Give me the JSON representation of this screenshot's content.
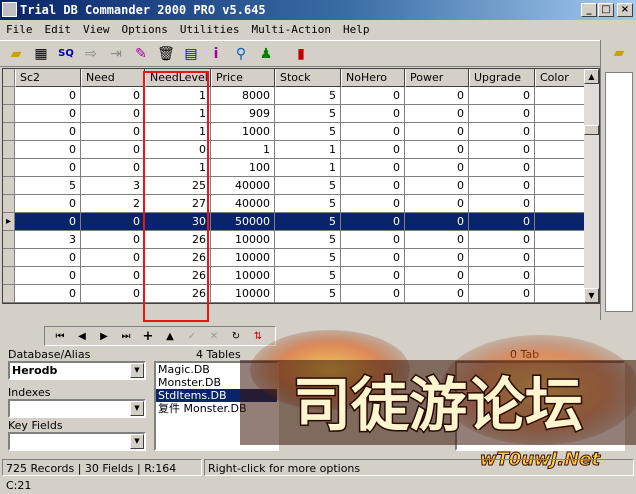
{
  "window": {
    "title": "Trial DB Commander 2000 PRO v5.645"
  },
  "menu": [
    "File",
    "Edit",
    "View",
    "Options",
    "Utilities",
    "Multi-Action",
    "Help"
  ],
  "grid": {
    "columns": [
      "Sc2",
      "Need",
      "NeedLevel",
      "Price",
      "Stock",
      "NoHero",
      "Power",
      "Upgrade",
      "Color"
    ],
    "rows": [
      [
        "0",
        "0",
        "1",
        "8000",
        "5",
        "0",
        "0",
        "0",
        ""
      ],
      [
        "0",
        "0",
        "1",
        "909",
        "5",
        "0",
        "0",
        "0",
        ""
      ],
      [
        "0",
        "0",
        "1",
        "1000",
        "5",
        "0",
        "0",
        "0",
        ""
      ],
      [
        "0",
        "0",
        "0",
        "1",
        "1",
        "0",
        "0",
        "0",
        ""
      ],
      [
        "0",
        "0",
        "1",
        "100",
        "1",
        "0",
        "0",
        "0",
        ""
      ],
      [
        "5",
        "3",
        "25",
        "40000",
        "5",
        "0",
        "0",
        "0",
        ""
      ],
      [
        "0",
        "2",
        "27",
        "40000",
        "5",
        "0",
        "0",
        "0",
        ""
      ],
      [
        "0",
        "0",
        "30",
        "50000",
        "5",
        "0",
        "0",
        "0",
        ""
      ],
      [
        "3",
        "0",
        "26",
        "10000",
        "5",
        "0",
        "0",
        "0",
        ""
      ],
      [
        "0",
        "0",
        "26",
        "10000",
        "5",
        "0",
        "0",
        "0",
        ""
      ],
      [
        "0",
        "0",
        "26",
        "10000",
        "5",
        "0",
        "0",
        "0",
        ""
      ],
      [
        "0",
        "0",
        "26",
        "10000",
        "5",
        "0",
        "0",
        "0",
        ""
      ]
    ],
    "selected_row": 7
  },
  "left_panel": {
    "database_label": "Database/Alias",
    "database_value": "Herodb",
    "indexes_label": "Indexes",
    "key_fields_label": "Key Fields"
  },
  "tables": {
    "header": "4 Tables",
    "items": [
      "Magic.DB",
      "Monster.DB",
      "StdItems.DB",
      "复件 Monster.DB"
    ],
    "selected_index": 2
  },
  "right_tables_header": "0 Tab",
  "status": {
    "records": "725 Records | 30 Fields | R:164 C:21",
    "hint": "Right-click for more options"
  },
  "watermark": {
    "main_text": "司徒游论坛",
    "sub_text": "wT0uwJ.Net"
  },
  "colors": {
    "selection": "#0a246a",
    "highlight_box": "#e8161a",
    "face": "#d4d0c8"
  }
}
